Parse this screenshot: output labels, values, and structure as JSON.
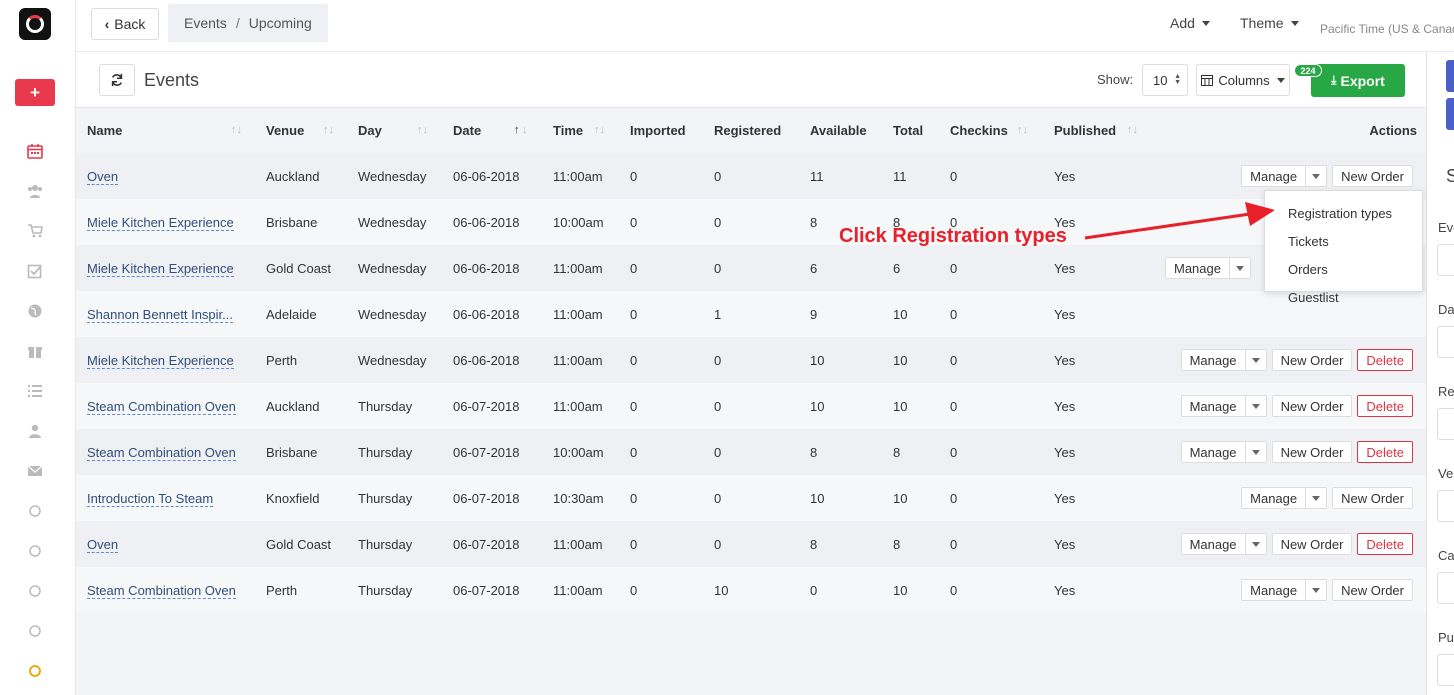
{
  "header": {
    "back_label": "Back",
    "breadcrumb": [
      "Events",
      "Upcoming"
    ],
    "add_label": "Add",
    "theme_label": "Theme",
    "timezone": "Pacific Time (US & Canada)"
  },
  "toolbar": {
    "title": "Events",
    "show_label": "Show:",
    "show_value": "10",
    "columns_label": "Columns",
    "export_label": "Export",
    "export_count": "224"
  },
  "table": {
    "columns": [
      "Name",
      "Venue",
      "Day",
      "Date",
      "Time",
      "Imported",
      "Registered",
      "Available",
      "Total",
      "Checkins",
      "Published",
      "Actions"
    ],
    "rows": [
      {
        "name": "Oven",
        "venue": "Auckland",
        "day": "Wednesday",
        "date": "06-06-2018",
        "time": "11:00am",
        "imported": "0",
        "registered": "0",
        "available": "11",
        "total": "11",
        "checkins": "0",
        "published": "Yes"
      },
      {
        "name": "Miele Kitchen Experience",
        "venue": "Brisbane",
        "day": "Wednesday",
        "date": "06-06-2018",
        "time": "10:00am",
        "imported": "0",
        "registered": "0",
        "available": "8",
        "total": "8",
        "checkins": "0",
        "published": "Yes"
      },
      {
        "name": "Miele Kitchen Experience",
        "venue": "Gold Coast",
        "day": "Wednesday",
        "date": "06-06-2018",
        "time": "11:00am",
        "imported": "0",
        "registered": "0",
        "available": "6",
        "total": "6",
        "checkins": "0",
        "published": "Yes"
      },
      {
        "name": "Shannon Bennett Inspir...",
        "venue": "Adelaide",
        "day": "Wednesday",
        "date": "06-06-2018",
        "time": "11:00am",
        "imported": "0",
        "registered": "1",
        "available": "9",
        "total": "10",
        "checkins": "0",
        "published": "Yes"
      },
      {
        "name": "Miele Kitchen Experience",
        "venue": "Perth",
        "day": "Wednesday",
        "date": "06-06-2018",
        "time": "11:00am",
        "imported": "0",
        "registered": "0",
        "available": "10",
        "total": "10",
        "checkins": "0",
        "published": "Yes"
      },
      {
        "name": "Steam Combination Oven",
        "venue": "Auckland",
        "day": "Thursday",
        "date": "06-07-2018",
        "time": "11:00am",
        "imported": "0",
        "registered": "0",
        "available": "10",
        "total": "10",
        "checkins": "0",
        "published": "Yes"
      },
      {
        "name": "Steam Combination Oven",
        "venue": "Brisbane",
        "day": "Thursday",
        "date": "06-07-2018",
        "time": "10:00am",
        "imported": "0",
        "registered": "0",
        "available": "8",
        "total": "8",
        "checkins": "0",
        "published": "Yes"
      },
      {
        "name": "Introduction To Steam",
        "venue": "Knoxfield",
        "day": "Thursday",
        "date": "06-07-2018",
        "time": "10:30am",
        "imported": "0",
        "registered": "0",
        "available": "10",
        "total": "10",
        "checkins": "0",
        "published": "Yes"
      },
      {
        "name": "Oven",
        "venue": "Gold Coast",
        "day": "Thursday",
        "date": "06-07-2018",
        "time": "11:00am",
        "imported": "0",
        "registered": "0",
        "available": "8",
        "total": "8",
        "checkins": "0",
        "published": "Yes"
      },
      {
        "name": "Steam Combination Oven",
        "venue": "Perth",
        "day": "Thursday",
        "date": "06-07-2018",
        "time": "11:00am",
        "imported": "0",
        "registered": "10",
        "available": "0",
        "total": "10",
        "checkins": "0",
        "published": "Yes"
      }
    ],
    "actions": {
      "manage": "Manage",
      "new_order": "New Order",
      "delete": "Delete"
    }
  },
  "manage_menu": [
    "Registration types",
    "Tickets",
    "Orders",
    "Guestlist"
  ],
  "annotation": "Click Registration types",
  "right_panel": {
    "heading": "S",
    "labels": [
      "Eve",
      "Da",
      "Re",
      "Ve",
      "Ca",
      "Pu"
    ]
  },
  "colors": {
    "accent_red": "#e8394d",
    "export_green": "#28a745",
    "annotation_red": "#e8202a"
  }
}
